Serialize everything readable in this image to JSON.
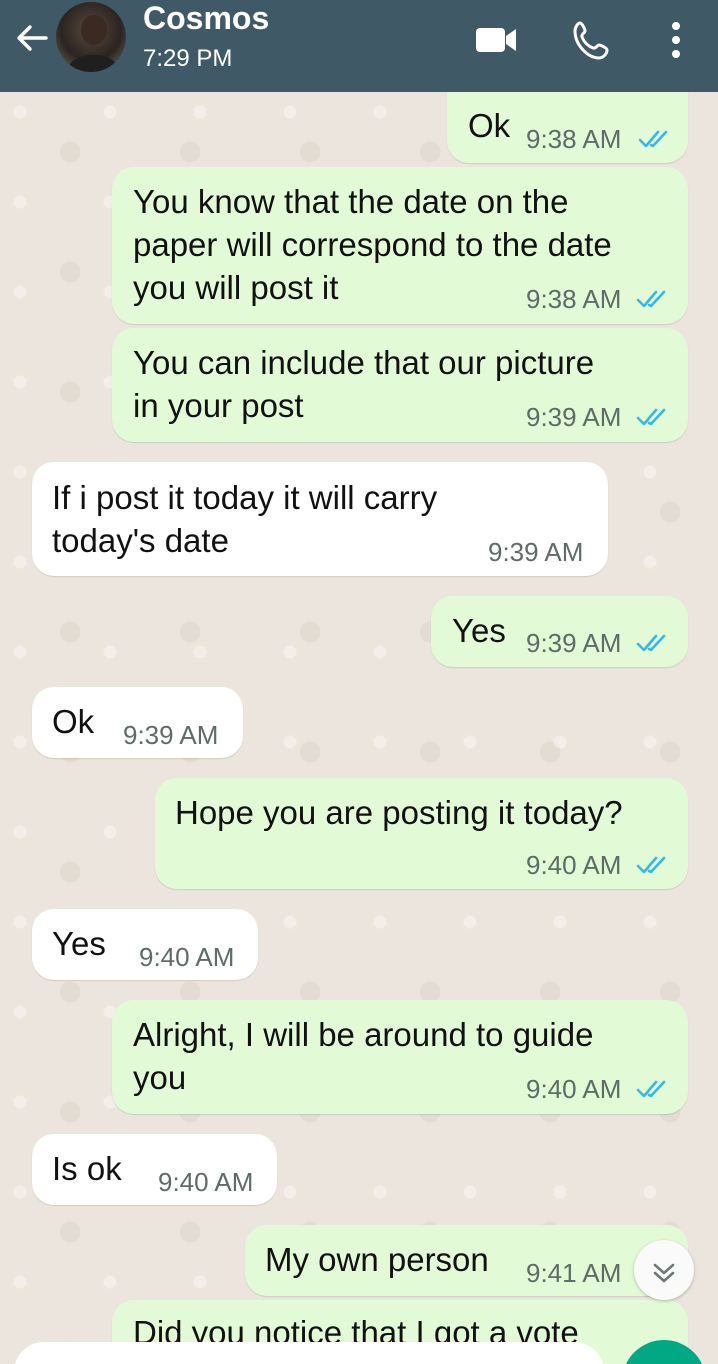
{
  "header": {
    "contact_name": "Cosmos",
    "status": "7:29 PM"
  },
  "messages": [
    {
      "text": "Ok",
      "time": "9:38 AM"
    },
    {
      "text": "You know that the date on the\npaper will correspond to the date\nyou will post it",
      "time": "9:38 AM"
    },
    {
      "text": "You can include that our picture\nin your post",
      "time": "9:39 AM"
    },
    {
      "text": "If i post it today it will carry\ntoday's date",
      "time": "9:39 AM"
    },
    {
      "text": "Yes",
      "time": "9:39 AM"
    },
    {
      "text": "Ok",
      "time": "9:39 AM"
    },
    {
      "text": "Hope you are posting it today?",
      "time": "9:40 AM"
    },
    {
      "text": "Yes",
      "time": "9:40 AM"
    },
    {
      "text": "Alright, I will be around to guide\nyou",
      "time": "9:40 AM"
    },
    {
      "text": "Is ok",
      "time": "9:40 AM"
    },
    {
      "text": "My own person",
      "time": "9:41 AM"
    },
    {
      "text": "Did you notice that I got a vote",
      "time": ""
    }
  ],
  "colors": {
    "header": "#3f5a66",
    "outgoing_bubble": "#e2fbd6",
    "incoming_bubble": "#ffffff",
    "read_ticks": "#34b7f1",
    "send_button": "#00a884"
  },
  "icons": [
    "back-arrow-icon",
    "video-call-icon",
    "phone-icon",
    "more-vert-icon",
    "double-check-icon",
    "scroll-down-icon"
  ]
}
